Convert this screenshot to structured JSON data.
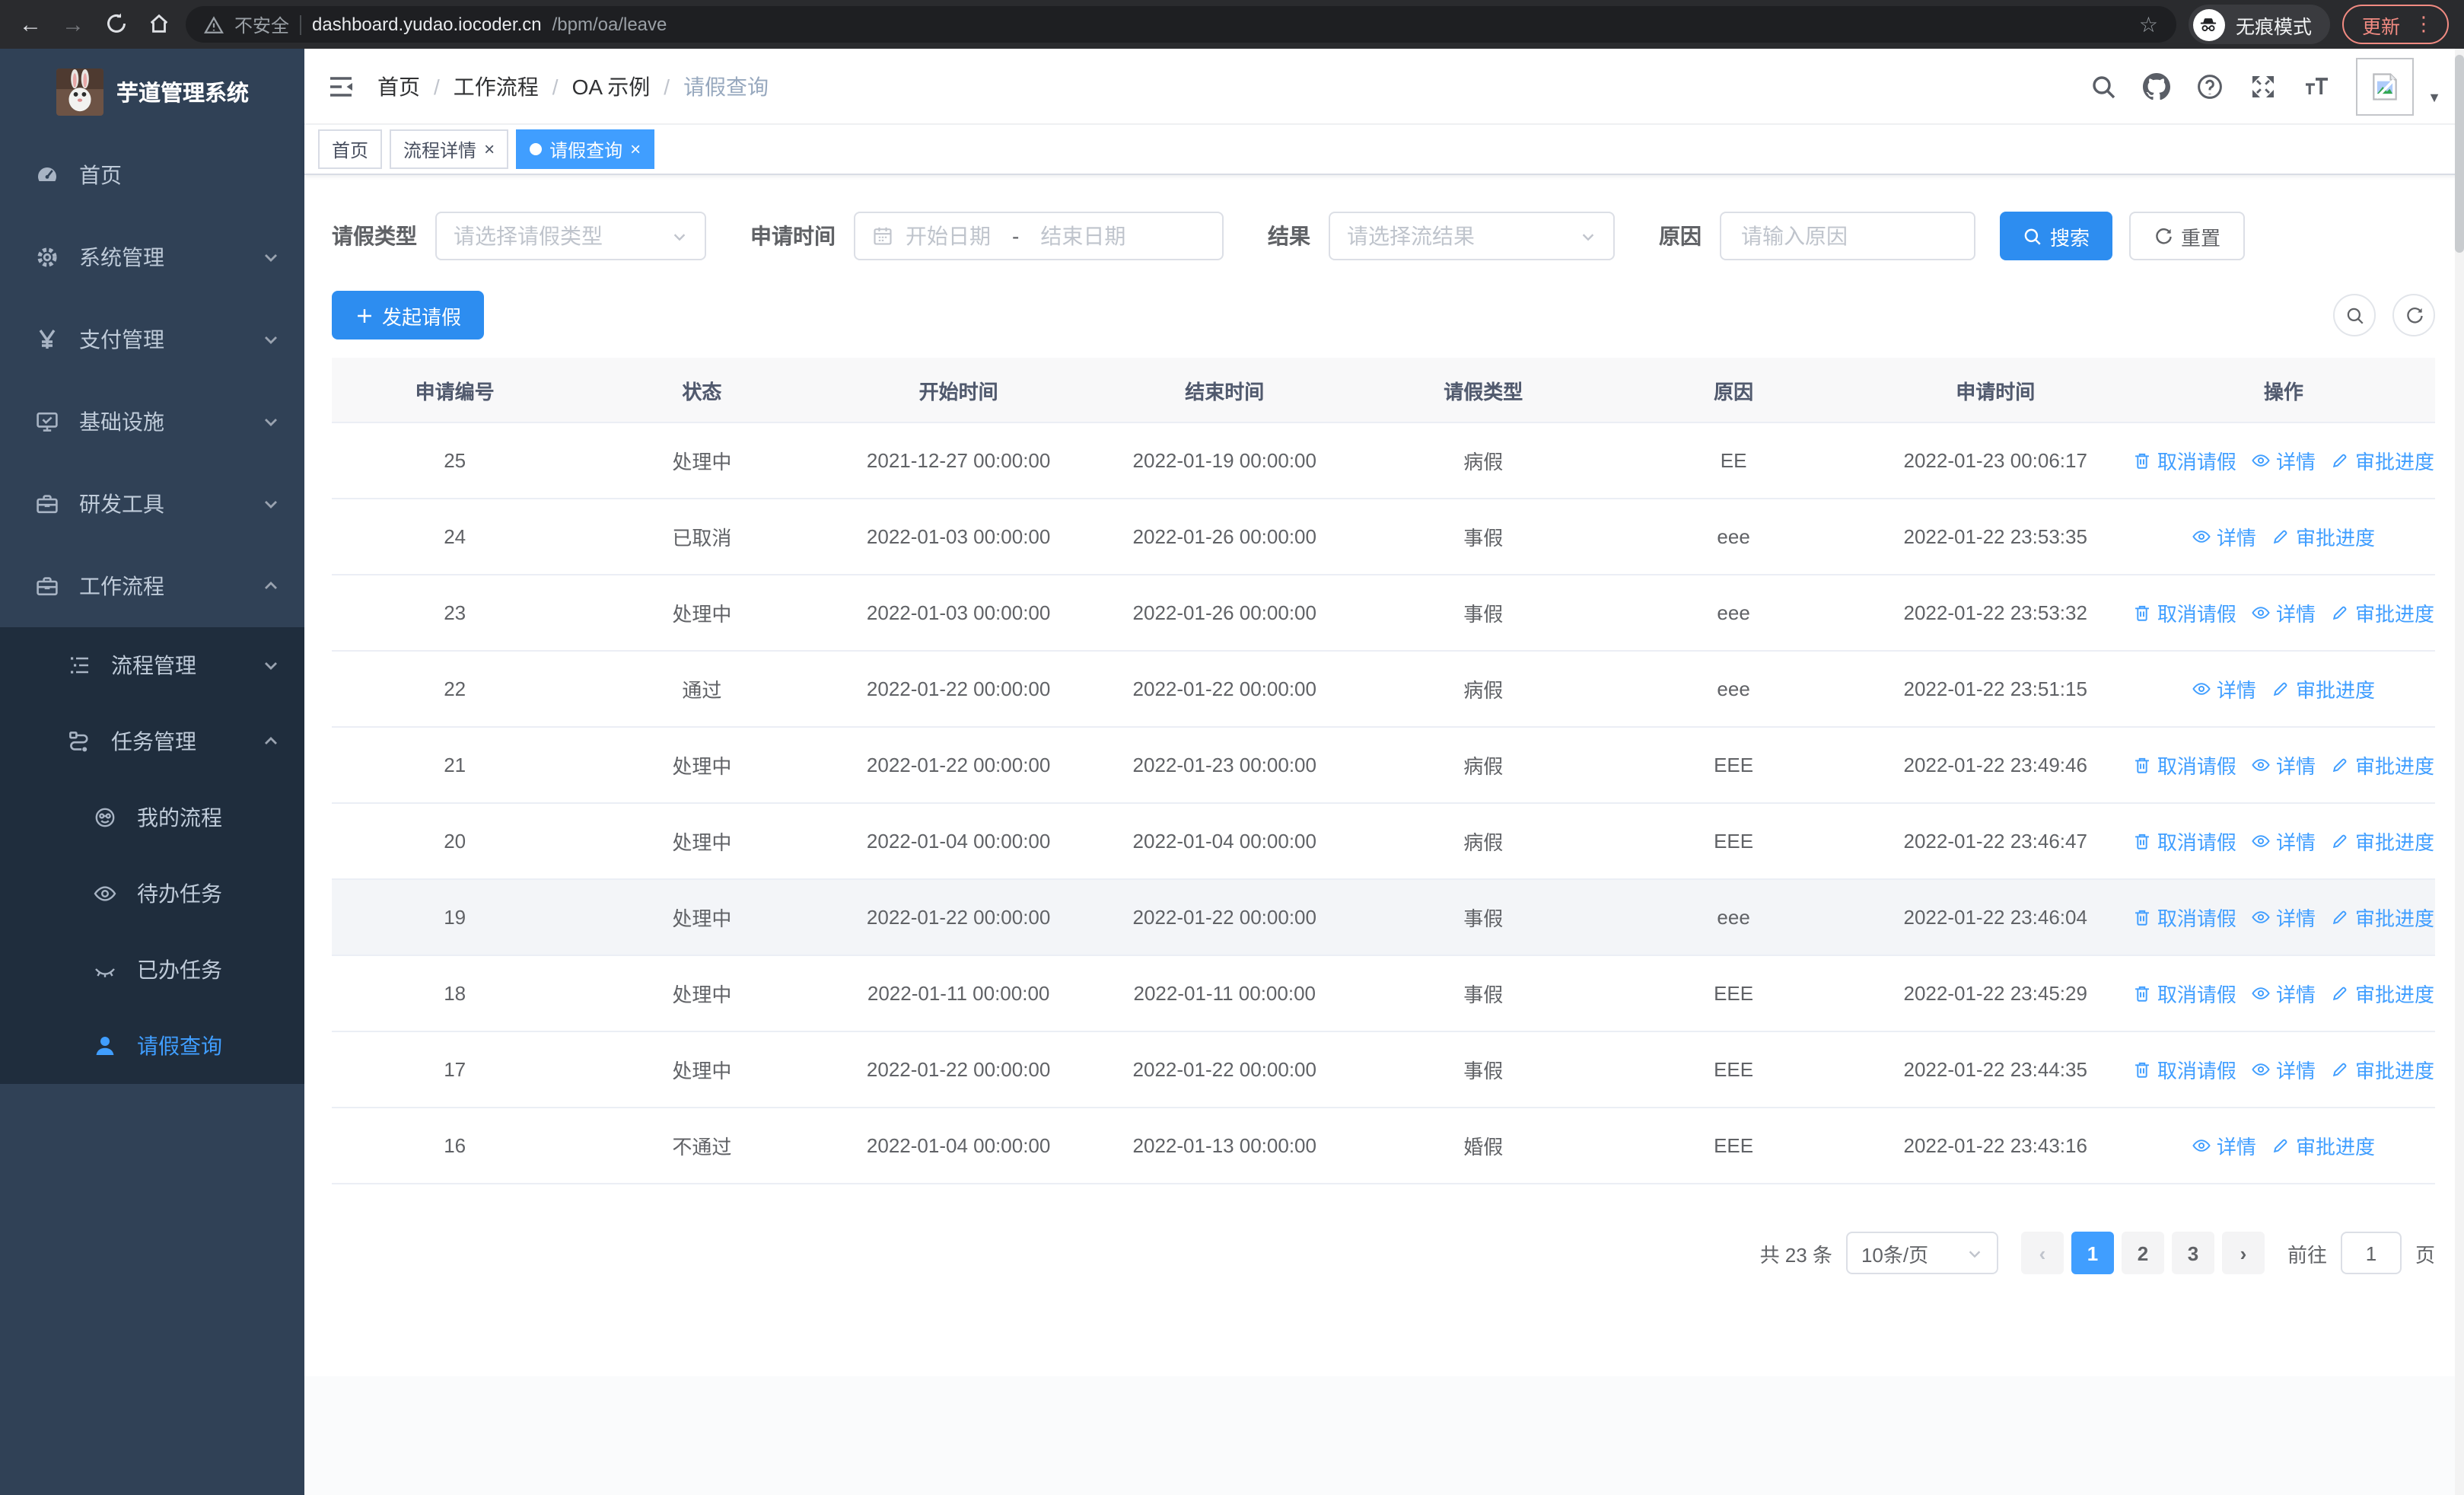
{
  "browser": {
    "security_label": "不安全",
    "url_host": "dashboard.yudao.iocoder.cn",
    "url_path": "/bpm/oa/leave",
    "incognito_label": "无痕模式",
    "update_label": "更新"
  },
  "glyphs": {
    "back": "←",
    "forward": "→",
    "star": "☆",
    "dots": "⋮",
    "caret_down": "▼",
    "breadcrumb_separator": "/",
    "close": "×",
    "prev": "‹",
    "next": "›"
  },
  "sidebar": {
    "title": "芋道管理系统",
    "items": [
      {
        "label": "首页"
      },
      {
        "label": "系统管理"
      },
      {
        "label": "支付管理"
      },
      {
        "label": "基础设施"
      },
      {
        "label": "研发工具"
      },
      {
        "label": "工作流程"
      }
    ],
    "submenu": [
      {
        "label": "流程管理"
      },
      {
        "label": "任务管理"
      }
    ],
    "submenu2": [
      {
        "label": "我的流程"
      },
      {
        "label": "待办任务"
      },
      {
        "label": "已办任务"
      },
      {
        "label": "请假查询"
      }
    ]
  },
  "header": {
    "breadcrumb": [
      "首页",
      "工作流程",
      "OA 示例",
      "请假查询"
    ]
  },
  "tabs": [
    {
      "label": "首页"
    },
    {
      "label": "流程详情"
    },
    {
      "label": "请假查询"
    }
  ],
  "filters": {
    "leave_type_label": "请假类型",
    "leave_type_placeholder": "请选择请假类型",
    "apply_time_label": "申请时间",
    "start_date_placeholder": "开始日期",
    "date_separator": "-",
    "end_date_placeholder": "结束日期",
    "result_label": "结果",
    "result_placeholder": "请选择流结果",
    "reason_label": "原因",
    "reason_placeholder": "请输入原因",
    "search_label": "搜索",
    "reset_label": "重置"
  },
  "toolbar": {
    "create_label": "发起请假"
  },
  "table": {
    "headers": [
      "申请编号",
      "状态",
      "开始时间",
      "结束时间",
      "请假类型",
      "原因",
      "申请时间",
      "操作"
    ],
    "action_labels": {
      "cancel": "取消请假",
      "detail": "详情",
      "progress": "审批进度"
    },
    "rows": [
      {
        "id": "25",
        "status": "处理中",
        "start": "2021-12-27 00:00:00",
        "end": "2022-01-19 00:00:00",
        "type": "病假",
        "reason": "EE",
        "applied": "2022-01-23 00:06:17"
      },
      {
        "id": "24",
        "status": "已取消",
        "start": "2022-01-03 00:00:00",
        "end": "2022-01-26 00:00:00",
        "type": "事假",
        "reason": "eee",
        "applied": "2022-01-22 23:53:35"
      },
      {
        "id": "23",
        "status": "处理中",
        "start": "2022-01-03 00:00:00",
        "end": "2022-01-26 00:00:00",
        "type": "事假",
        "reason": "eee",
        "applied": "2022-01-22 23:53:32"
      },
      {
        "id": "22",
        "status": "通过",
        "start": "2022-01-22 00:00:00",
        "end": "2022-01-22 00:00:00",
        "type": "病假",
        "reason": "eee",
        "applied": "2022-01-22 23:51:15"
      },
      {
        "id": "21",
        "status": "处理中",
        "start": "2022-01-22 00:00:00",
        "end": "2022-01-23 00:00:00",
        "type": "病假",
        "reason": "EEE",
        "applied": "2022-01-22 23:49:46"
      },
      {
        "id": "20",
        "status": "处理中",
        "start": "2022-01-04 00:00:00",
        "end": "2022-01-04 00:00:00",
        "type": "病假",
        "reason": "EEE",
        "applied": "2022-01-22 23:46:47"
      },
      {
        "id": "19",
        "status": "处理中",
        "start": "2022-01-22 00:00:00",
        "end": "2022-01-22 00:00:00",
        "type": "事假",
        "reason": "eee",
        "applied": "2022-01-22 23:46:04"
      },
      {
        "id": "18",
        "status": "处理中",
        "start": "2022-01-11 00:00:00",
        "end": "2022-01-11 00:00:00",
        "type": "事假",
        "reason": "EEE",
        "applied": "2022-01-22 23:45:29"
      },
      {
        "id": "17",
        "status": "处理中",
        "start": "2022-01-22 00:00:00",
        "end": "2022-01-22 00:00:00",
        "type": "事假",
        "reason": "EEE",
        "applied": "2022-01-22 23:44:35"
      },
      {
        "id": "16",
        "status": "不通过",
        "start": "2022-01-04 00:00:00",
        "end": "2022-01-13 00:00:00",
        "type": "婚假",
        "reason": "EEE",
        "applied": "2022-01-22 23:43:16"
      }
    ]
  },
  "pagination": {
    "total_label": "共 23 条",
    "page_size": "10条/页",
    "pages": [
      "1",
      "2",
      "3"
    ],
    "goto_label": "前往",
    "goto_value": "1",
    "page_label": "页"
  },
  "colors": {
    "accent": "#409eff",
    "sidebar_bg": "#304156",
    "submenu_bg": "#1f2d3d",
    "update_red": "#f28b82"
  }
}
